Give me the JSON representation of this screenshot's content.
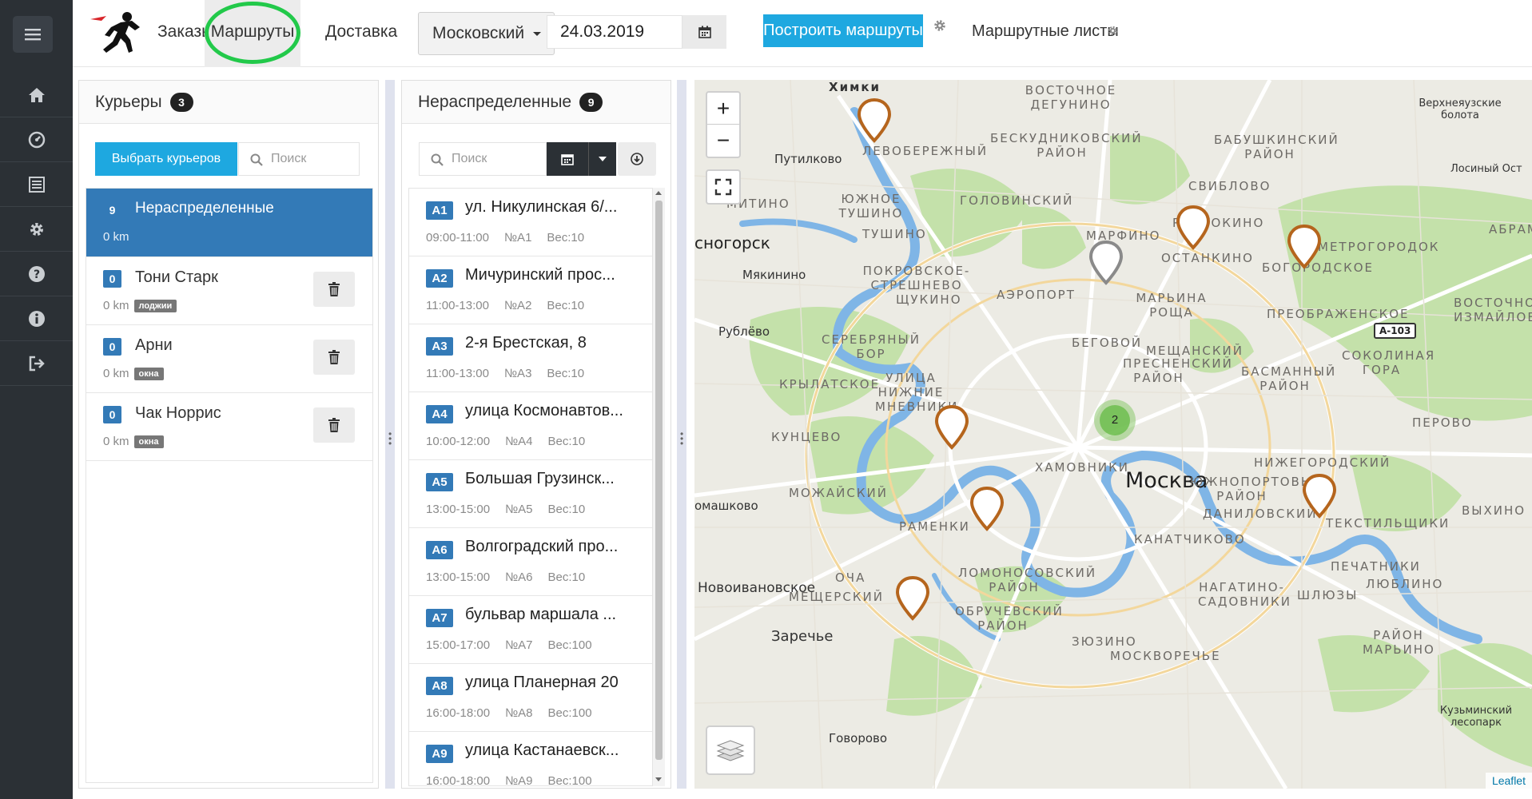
{
  "sidebar": {
    "menu_icon": "hamburger-icon",
    "items": [
      {
        "icon": "home-icon"
      },
      {
        "icon": "dashboard-icon"
      },
      {
        "icon": "list-icon"
      },
      {
        "icon": "gear-icon"
      },
      {
        "icon": "help-icon"
      },
      {
        "icon": "info-icon"
      },
      {
        "icon": "logout-icon"
      }
    ]
  },
  "topbar": {
    "nav": {
      "orders": "Заказы",
      "routes": "Маршруты",
      "delivery": "Доставка"
    },
    "active_tab": "routes",
    "district": "Московский",
    "date": "24.03.2019",
    "build_routes": "Построить маршруты",
    "route_sheets": "Маршрутные листы"
  },
  "couriers": {
    "title": "Курьеры",
    "count": "3",
    "select_button": "Выбрать курьеров",
    "search_placeholder": "Поиск",
    "unassigned": {
      "count": "9",
      "name": "Нераспределенные",
      "km": "0 km"
    },
    "items": [
      {
        "count": "0",
        "name": "Тони Старк",
        "km": "0 km",
        "tag": "лоджии"
      },
      {
        "count": "0",
        "name": "Арни",
        "km": "0 km",
        "tag": "окна"
      },
      {
        "count": "0",
        "name": "Чак Норрис",
        "km": "0 km",
        "tag": "окна"
      }
    ]
  },
  "unassigned": {
    "title": "Нераспределенные",
    "count": "9",
    "search_placeholder": "Поиск",
    "orders": [
      {
        "code": "A1",
        "address": "ул. Никулинская 6/...",
        "time": "09:00-11:00",
        "num": "№A1",
        "weight": "Вес:10"
      },
      {
        "code": "A2",
        "address": "Мичуринский прос...",
        "time": "11:00-13:00",
        "num": "№A2",
        "weight": "Вес:10"
      },
      {
        "code": "A3",
        "address": "2-я Брестская, 8",
        "time": "11:00-13:00",
        "num": "№A3",
        "weight": "Вес:10"
      },
      {
        "code": "A4",
        "address": "улица Космонавтов...",
        "time": "10:00-12:00",
        "num": "№A4",
        "weight": "Вес:10"
      },
      {
        "code": "A5",
        "address": "Большая Грузинск...",
        "time": "13:00-15:00",
        "num": "№A5",
        "weight": "Вес:10"
      },
      {
        "code": "A6",
        "address": "Волгоградский про...",
        "time": "13:00-15:00",
        "num": "№A6",
        "weight": "Вес:10"
      },
      {
        "code": "A7",
        "address": "бульвар маршала ...",
        "time": "15:00-17:00",
        "num": "№A7",
        "weight": "Вес:100"
      },
      {
        "code": "A8",
        "address": "улица Планерная 20",
        "time": "16:00-18:00",
        "num": "№A8",
        "weight": "Вес:100"
      },
      {
        "code": "A9",
        "address": "улица Кастанаевск...",
        "time": "16:00-18:00",
        "num": "№A9",
        "weight": "Вес:100"
      }
    ]
  },
  "map": {
    "zoom_in": "+",
    "zoom_out": "−",
    "cluster_count": "2",
    "attribution": "Leaflet",
    "colors": {
      "pin_active": "#b5651d",
      "pin_inactive": "#8a8a8a",
      "cluster": "#7cc35a",
      "water": "#6fa8dc",
      "park": "#b8dc9a"
    },
    "labels": {
      "city": "Москва",
      "khimki": "Химки",
      "krasnogorsk": "сногорск",
      "putilkovo": "Путилково",
      "myakinino": "Мякинино",
      "rublevo": "Рублёво",
      "romashkovo": "омашково",
      "novoivankovo": "Новоивановское",
      "zarechye": "Заречье",
      "govorovo": "Говорово",
      "verkh_boloto": "Верхнеяузские болота",
      "losiny": "Лосиный Ост",
      "kuzminsky": "Кузьминский лесопарк",
      "a103": "А-103",
      "districts": [
        "ВОСТОЧНОЕ ДЕГУНИНО",
        "ЛЕВОБЕРЕЖНЫЙ",
        "БЕСКУДНИКОВСКИЙ РАЙОН",
        "БАБУШКИНСКИЙ РАЙОН",
        "СВИБЛОВО",
        "ГОЛОВИНСКИЙ",
        "ЮЖНОЕ ТУШИНО",
        "МИТИНО",
        "ТУШИНО",
        "МАРФИНО",
        "РОСТОКИНО",
        "ОСТАНКИНО",
        "БОГОРОДСКОЕ",
        "МЕТРОГОРОДОК",
        "АБРАМ",
        "ПОКРОВСКОЕ-СТРЕШНЕВО",
        "АЭРОПОРТ",
        "МАРЬИНА РОЩА",
        "ЩУКИНО",
        "ПРЕОБРАЖЕНСКОЕ",
        "ВОСТОЧНО ИЗМАЙЛОВ",
        "СЕРЕБРЯНЫЙ БОР",
        "БЕГОВОЙ",
        "МЕЩАНСКИЙ",
        "СОКОЛИНАЯ ГОРА",
        "БАСМАННЫЙ РАЙОН",
        "ПРЕСНЕНСКИЙ РАЙОН",
        "КРЫЛАТСКОЕ",
        "УЛИЦА НИЖНИЕ МНЕВНИКИ",
        "КУНЦЕВО",
        "ПЕРОВО",
        "ХАМОВНИКИ",
        "НИЖЕГОРОДСКИЙ",
        "ЮЖНОПОРТОВЫЙ РАЙОН",
        "МОЖАЙСКИЙ",
        "ВЫХИНО",
        "ДАНИЛОВСКИЙ",
        "ТЕКСТИЛЬЩИКИ",
        "РАМЕНКИ",
        "КАНАТЧИКОВО",
        "ПЕЧАТНИКИ",
        "ЛОМОНОСОВСКИЙ РАЙОН",
        "ОЧА",
        "НАГАТИНО-САДОВНИКИ",
        "ШЛЮЗЫ",
        "ЛЮБЛИНО",
        "МЕЩЕРСКИЙ",
        "ОБРУЧЕВСКИЙ РАЙОН",
        "ЗЮЗИНО",
        "РАЙОН МАРЬИНО",
        "МОСКВОРЕЧЬЕ"
      ]
    }
  }
}
